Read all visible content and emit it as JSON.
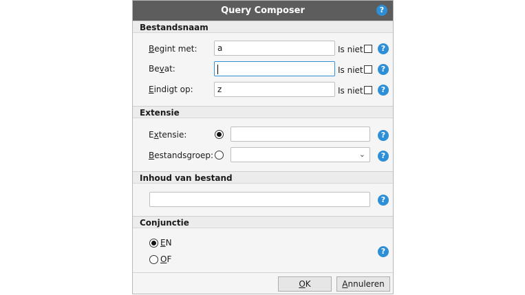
{
  "dialog": {
    "title": "Query Composer"
  },
  "help_glyph": "?",
  "bestandsnaam": {
    "header": "Bestandsnaam",
    "begint_met": {
      "accel": "B",
      "rest": "egint met:",
      "value": "a"
    },
    "bevat": {
      "prefix": "Be",
      "accel": "v",
      "rest": "at:",
      "value": ""
    },
    "eindigt_op": {
      "accel": "E",
      "rest": "indigt op:",
      "value": "z"
    },
    "is_niet_label": "Is niet"
  },
  "extensie": {
    "header": "Extensie",
    "extensie_label": {
      "prefix": "E",
      "accel": "x",
      "rest": "tensie:"
    },
    "extensie_value": "",
    "bestandsgroep_label": {
      "accel": "B",
      "rest": "estandsgroep:"
    },
    "bestandsgroep_value": ""
  },
  "inhoud": {
    "header": "Inhoud van bestand",
    "value": ""
  },
  "conjunctie": {
    "header": "Conjunctie",
    "en": {
      "accel": "E",
      "rest": "N"
    },
    "of": {
      "accel": "O",
      "rest": "F"
    }
  },
  "buttons": {
    "ok": {
      "accel": "O",
      "rest": "K"
    },
    "annuleren": {
      "accel": "A",
      "rest": "nnuleren"
    }
  }
}
